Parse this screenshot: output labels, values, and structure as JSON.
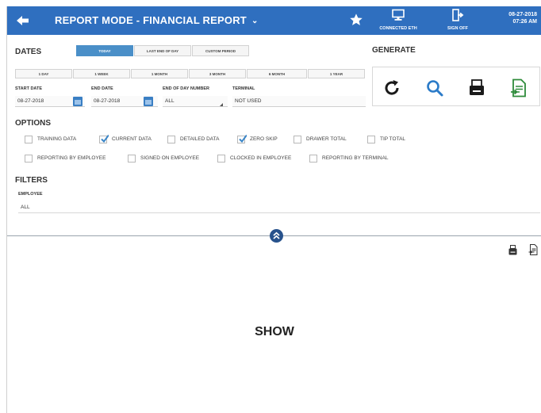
{
  "header": {
    "title": "REPORT MODE - FINANCIAL REPORT",
    "caret": "⌄",
    "connected_label": "CONNECTED ETH",
    "sign_off_label": "SIGN OFF",
    "date": "08-27-2018",
    "time": "07:26 AM",
    "bg_color": "#2f6fbf"
  },
  "dates": {
    "label": "DATES",
    "tabs": [
      {
        "label": "TODAY",
        "active": true
      },
      {
        "label": "LAST END OF DAY",
        "active": false
      },
      {
        "label": "CUSTOM PERIOD",
        "active": false
      }
    ],
    "ranges": [
      "1 DAY",
      "1 WEEK",
      "1 MONTH",
      "3 MONTH",
      "6 MONTH",
      "1 YEAR"
    ],
    "start_label": "START DATE",
    "start_value": "08-27-2018",
    "end_label": "END DATE",
    "end_value": "08-27-2018",
    "eod_label": "END OF DAY NUMBER",
    "eod_value": "ALL",
    "terminal_label": "TERMINAL",
    "terminal_value": "NOT USED"
  },
  "generate": {
    "label": "GENERATE",
    "icons": [
      "refresh-icon",
      "search-icon",
      "print-icon",
      "export-icon"
    ]
  },
  "options": {
    "label": "OPTIONS",
    "row1": [
      {
        "label": "TRAINING DATA",
        "checked": false
      },
      {
        "label": "CURRENT DATA",
        "checked": true
      },
      {
        "label": "DETAILED DATA",
        "checked": false
      },
      {
        "label": "ZERO SKIP",
        "checked": true
      },
      {
        "label": "DRAWER TOTAL",
        "checked": false
      },
      {
        "label": "TIP TOTAL",
        "checked": false
      }
    ],
    "row2": [
      {
        "label": "REPORTING BY EMPLOYEE",
        "checked": false
      },
      {
        "label": "SIGNED ON EMPLOYEE",
        "checked": false
      },
      {
        "label": "CLOCKED IN EMPLOYEE",
        "checked": false
      },
      {
        "label": "REPORTING BY TERMINAL",
        "checked": false
      }
    ]
  },
  "filters": {
    "label": "FILTERS",
    "employee_label": "EMPLOYEE",
    "employee_value": "ALL"
  },
  "result": {
    "show_label": "SHOW"
  },
  "colors": {
    "accent": "#4a8fc8",
    "check": "#3a86c8",
    "icon_blue": "#2b7bc8",
    "icon_green": "#2e8b3a"
  }
}
